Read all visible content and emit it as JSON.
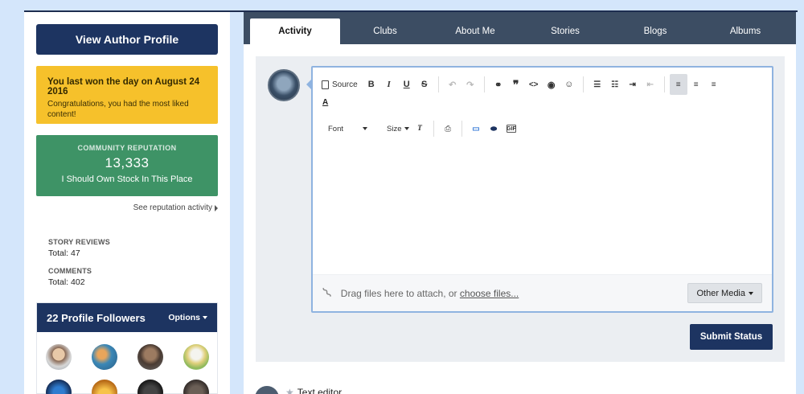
{
  "sidebar": {
    "view_profile": "View Author Profile",
    "won": {
      "title": "You last won the day on August 24 2016",
      "subtitle": "Congratulations, you had the most liked content!"
    },
    "reputation": {
      "heading": "COMMUNITY REPUTATION",
      "value": "13,333",
      "label": "I Should Own Stock In This Place"
    },
    "reputation_link": "See reputation activity",
    "stats": [
      {
        "label": "STORY REVIEWS",
        "value": "Total: 47"
      },
      {
        "label": "COMMENTS",
        "value": "Total: 402"
      }
    ],
    "followers": {
      "title": "22 Profile Followers",
      "options": "Options"
    }
  },
  "tabs": [
    "Activity",
    "Clubs",
    "About Me",
    "Stories",
    "Blogs",
    "Albums"
  ],
  "active_tab": "Activity",
  "editor": {
    "source": "Source",
    "font": "Font",
    "size": "Size",
    "attach_text": "Drag files here to attach, or",
    "attach_link": "choose files...",
    "other_media": "Other Media"
  },
  "submit_label": "Submit Status",
  "entry_text": "Text editor",
  "colors": {
    "navy": "#1d3461",
    "gold": "#f6c12b",
    "green": "#3e9366",
    "tabbar": "#3c4d63"
  }
}
